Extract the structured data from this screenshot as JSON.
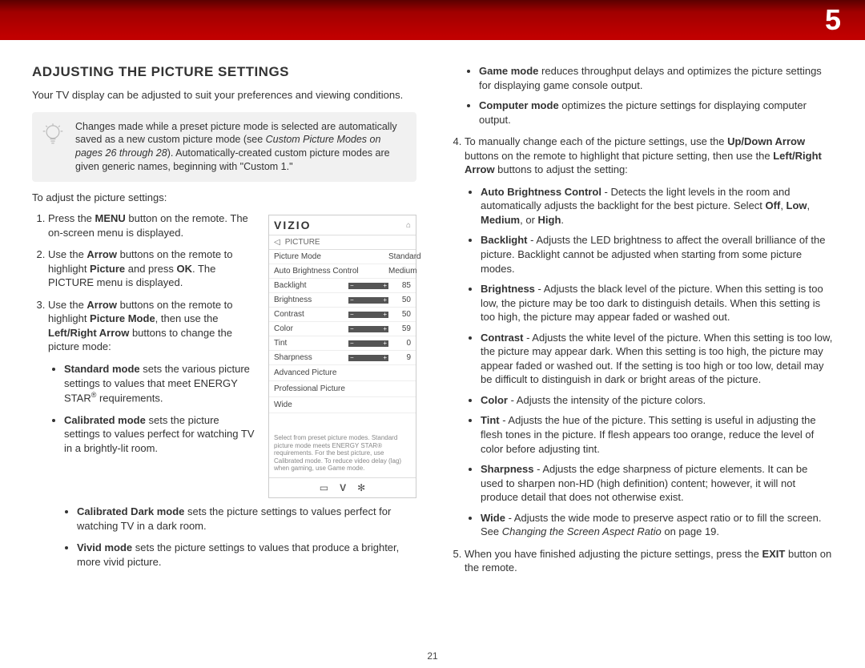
{
  "chapter": "5",
  "page_number": "21",
  "title": "ADJUSTING THE PICTURE SETTINGS",
  "intro": "Your TV display can be adjusted to suit your preferences and viewing conditions.",
  "tip": {
    "text_a": "Changes made while a preset picture mode is selected are automatically saved as a new custom picture mode (see ",
    "text_ref": "Custom Picture Modes on pages 26 through 28",
    "text_b": "). Automatically-created custom picture modes are given generic names, beginning with \"Custom 1.\""
  },
  "lead_in": "To adjust the picture settings:",
  "steps_left": {
    "s1a": "Press the ",
    "s1b": "MENU",
    "s1c": " button on the remote. The on-screen menu is displayed.",
    "s2a": "Use the ",
    "s2b": "Arrow",
    "s2c": " buttons on the remote to highlight ",
    "s2d": "Picture",
    "s2e": " and press ",
    "s2f": "OK",
    "s2g": ". The PICTURE menu is displayed.",
    "s3a": "Use the ",
    "s3b": "Arrow",
    "s3c": " buttons on the remote to highlight ",
    "s3d": "Picture Mode",
    "s3e": ", then use the ",
    "s3f": "Left/Right Arrow",
    "s3g": " buttons to change the picture mode:"
  },
  "modes_left": {
    "m1a": "Standard mode",
    "m1b": " sets the various picture settings to values that meet ENERGY STAR",
    "m1c": " requirements.",
    "m2a": "Calibrated mode",
    "m2b": " sets the picture settings to values perfect for watching TV in a brightly-lit room.",
    "m3a": "Calibrated Dark mode",
    "m3b": " sets the picture settings to values perfect for watching TV in a dark room.",
    "m4a": "Vivid mode",
    "m4b": " sets the picture settings to values that produce a brighter, more vivid picture."
  },
  "modes_right_top": {
    "m5a": "Game mode",
    "m5b": " reduces throughput delays and optimizes the picture settings for displaying game console output.",
    "m6a": "Computer mode",
    "m6b": " optimizes the picture settings for displaying computer output."
  },
  "step4": {
    "a": "To manually change each of the picture settings, use the ",
    "b": "Up/Down Arrow",
    "c": " buttons on the remote to highlight that picture setting, then use the ",
    "d": "Left/Right Arrow",
    "e": " buttons to adjust the setting:"
  },
  "settings_defs": {
    "d1a": "Auto Brightness Control",
    "d1b": " - Detects the light levels in the room and automatically adjusts the backlight for the best picture. Select ",
    "d1c": "Off",
    "d1d": ", ",
    "d1e": "Low",
    "d1f": ", ",
    "d1g": "Medium",
    "d1h": ", or ",
    "d1i": "High",
    "d1j": ".",
    "d2a": "Backlight",
    "d2b": " - Adjusts the LED brightness to affect the overall brilliance of the picture. Backlight cannot be adjusted when starting from some picture modes.",
    "d3a": "Brightness",
    "d3b": " - Adjusts the black level of the picture. When this setting is too low, the picture may be too dark to distinguish details. When this setting is too high, the picture may appear faded or washed out.",
    "d4a": "Contrast",
    "d4b": " - Adjusts the white level of the picture. When this setting is too low, the picture may appear dark. When this setting is too high, the picture may appear faded or washed out. If the setting is too high or too low, detail may be difficult to distinguish in dark or bright areas of the picture.",
    "d5a": "Color",
    "d5b": " - Adjusts the intensity of the picture colors.",
    "d6a": "Tint",
    "d6b": " - Adjusts the hue of the picture. This setting is useful in adjusting the flesh tones in the picture. If flesh appears too orange, reduce the level of color before adjusting tint.",
    "d7a": "Sharpness",
    "d7b": " - Adjusts the edge sharpness of picture elements. It can be used to sharpen non-HD (high definition) content; however, it will not produce detail that does not otherwise exist.",
    "d8a": "Wide",
    "d8b": " - Adjusts the wide mode to preserve aspect ratio or to fill the screen. See ",
    "d8c": "Changing the Screen Aspect Ratio",
    "d8d": " on page 19."
  },
  "step5": {
    "a": "When you have finished adjusting the picture settings, press the ",
    "b": "EXIT",
    "c": " button on the remote."
  },
  "osd": {
    "logo": "VIZIO",
    "breadcrumb": "PICTURE",
    "rows": [
      {
        "label": "Picture Mode",
        "value": "Standard",
        "slider": false
      },
      {
        "label": "Auto Brightness Control",
        "value": "Medium",
        "slider": false
      },
      {
        "label": "Backlight",
        "value": "85",
        "slider": true
      },
      {
        "label": "Brightness",
        "value": "50",
        "slider": true
      },
      {
        "label": "Contrast",
        "value": "50",
        "slider": true
      },
      {
        "label": "Color",
        "value": "59",
        "slider": true
      },
      {
        "label": "Tint",
        "value": "0",
        "slider": true
      },
      {
        "label": "Sharpness",
        "value": "9",
        "slider": true
      }
    ],
    "simple": [
      "Advanced Picture",
      "Professional Picture",
      "Wide"
    ],
    "footer": "Select from preset picture modes. Standard picture mode meets ENERGY STAR® requirements. For the best picture, use Calibrated mode. To reduce video delay (lag) when gaming, use Game mode."
  }
}
